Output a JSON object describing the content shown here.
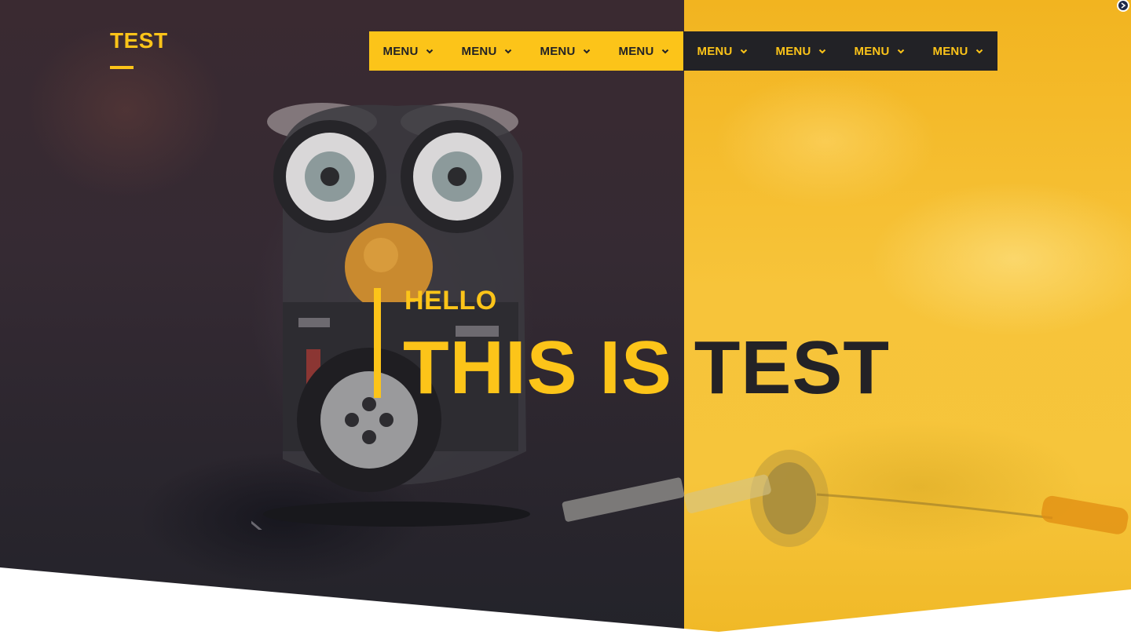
{
  "brand": {
    "logo_text": "TEST"
  },
  "nav": {
    "items": [
      {
        "label": "MENU",
        "icon": "chevron-down-icon"
      },
      {
        "label": "MENU",
        "icon": "chevron-down-icon"
      },
      {
        "label": "MENU",
        "icon": "chevron-down-icon"
      },
      {
        "label": "MENU",
        "icon": "chevron-down-icon"
      },
      {
        "label": "MENU",
        "icon": "chevron-down-icon"
      },
      {
        "label": "MENU",
        "icon": "chevron-down-icon"
      },
      {
        "label": "MENU",
        "icon": "chevron-down-icon"
      },
      {
        "label": "MENU",
        "icon": "chevron-down-icon"
      }
    ]
  },
  "hero": {
    "kicker": "HELLO",
    "headline_part1": "THIS IS ",
    "headline_part2": "TEST",
    "background_image": "robot-on-workbench-photo"
  },
  "colors": {
    "accent_yellow": "#fcc419",
    "dark": "#222226",
    "background_white": "#ffffff"
  }
}
